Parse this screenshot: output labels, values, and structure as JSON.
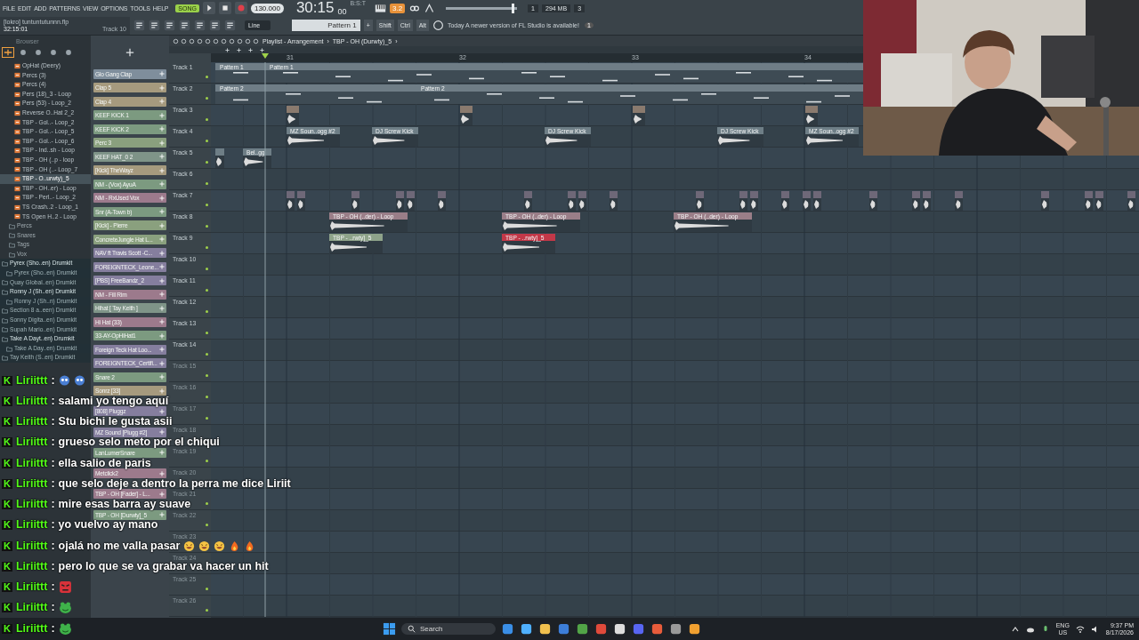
{
  "menu": [
    "FILE",
    "EDIT",
    "ADD",
    "PATTERNS",
    "VIEW",
    "OPTIONS",
    "TOOLS",
    "HELP"
  ],
  "project": {
    "file": "[lokro] tuntuntutunnn.flp",
    "position": "32:15:01",
    "hint": "Track 10"
  },
  "transport": {
    "mode": "SONG",
    "tempo": "130.000",
    "time": "30:15",
    "time_ticks": "00",
    "time_format": "B:S:T",
    "snap": "3.2"
  },
  "master_volume": {
    "level": 0.92
  },
  "monitor": {
    "cpu": "1",
    "polyphony": "3",
    "memory": "294 MB"
  },
  "input": "Line",
  "pattern": "Pattern 1",
  "pattern_add": "+",
  "modifiers": [
    "Shift",
    "Ctrl",
    "Alt"
  ],
  "news": {
    "day": "Today",
    "text": "A newer version of FL Studio is available!",
    "badge": "1"
  },
  "browser": {
    "title": "Browser",
    "items": [
      {
        "kind": "file",
        "name": "OpHat (Deery)",
        "selected": false
      },
      {
        "kind": "file",
        "name": "Percs (3)",
        "selected": false
      },
      {
        "kind": "file",
        "name": "Percs (4)",
        "selected": false
      },
      {
        "kind": "file",
        "name": "Pers (18)_3 - Loop",
        "selected": false
      },
      {
        "kind": "file",
        "name": "Pers (53) - Loop_2",
        "selected": false
      },
      {
        "kind": "file",
        "name": "Reverse O..Hat 2_2",
        "selected": false
      },
      {
        "kind": "file",
        "name": "TBP - Gol..- Loop_2",
        "selected": false
      },
      {
        "kind": "file",
        "name": "TBP - Gol..- Loop_5",
        "selected": false
      },
      {
        "kind": "file",
        "name": "TBP - Gol..- Loop_6",
        "selected": false
      },
      {
        "kind": "file",
        "name": "TBP - Ind..sh - Loop",
        "selected": false
      },
      {
        "kind": "file",
        "name": "TBP - OH (..p - loop",
        "selected": false
      },
      {
        "kind": "file",
        "name": "TBP - OH (..- Loop_7",
        "selected": false
      },
      {
        "kind": "file",
        "name": "TBP - O..urwty)_5",
        "selected": true
      },
      {
        "kind": "file",
        "name": "TBP - OH..er) - Loop",
        "selected": false
      },
      {
        "kind": "file",
        "name": "TBP - Perl..- Loop_2",
        "selected": false
      },
      {
        "kind": "file",
        "name": "TS Crash..2 - Loop_1",
        "selected": false
      },
      {
        "kind": "file",
        "name": "TS Open H..2 - Loop",
        "selected": false
      },
      {
        "kind": "folder",
        "name": "Percs",
        "selected": false
      },
      {
        "kind": "folder",
        "name": "Snares",
        "selected": false
      },
      {
        "kind": "folder",
        "name": "Tags",
        "selected": false
      },
      {
        "kind": "folder",
        "name": "Vox",
        "selected": false
      },
      {
        "kind": "kit",
        "name": "Pyrex (Sho..en) Drumkit",
        "selected": false,
        "expanded": true,
        "children": [
          {
            "kind": "kit",
            "name": "Pyrex (Sho..en) Drumkit",
            "selected": false,
            "expanded": false
          }
        ]
      },
      {
        "kind": "kit",
        "name": "Quay Global..en) Drumkit",
        "selected": false,
        "expanded": false
      },
      {
        "kind": "kit",
        "name": "Ronny J (Sh..en) Drumkit",
        "selected": false,
        "expanded": true,
        "children": [
          {
            "kind": "kit",
            "name": "Ronny J (Sh..n) Drumkit",
            "selected": false,
            "expanded": false
          }
        ]
      },
      {
        "kind": "kit",
        "name": "Section 8 a..een) Drumkit",
        "selected": false,
        "expanded": false
      },
      {
        "kind": "kit",
        "name": "Sonny Digita..en) Drumkit",
        "selected": false,
        "expanded": false
      },
      {
        "kind": "kit",
        "name": "Supah Mario..en) Drumkit",
        "selected": false,
        "expanded": false
      },
      {
        "kind": "kit",
        "name": "Take A Dayt..en) Drumkit",
        "selected": false,
        "expanded": true,
        "children": [
          {
            "kind": "kit",
            "name": "Take A Day..en) Drumkit",
            "selected": false,
            "expanded": false
          }
        ]
      },
      {
        "kind": "kit",
        "name": "Tay Keith (S..en) Drumkit",
        "selected": false,
        "expanded": false
      }
    ]
  },
  "channels": [
    {
      "name": "Glo Gang Clap",
      "color": "#7f8e9c"
    },
    {
      "name": "Clap 5",
      "color": "#a69a7e"
    },
    {
      "name": "Clap 4",
      "color": "#a69a7e"
    },
    {
      "name": "KEEF KICK 1",
      "color": "#7c9a80"
    },
    {
      "name": "KEEF KICK 2",
      "color": "#7c9a80"
    },
    {
      "name": "Perc 3",
      "color": "#8aa07e"
    },
    {
      "name": "KEEF HAT_0 2",
      "color": "#7f9488"
    },
    {
      "name": "[Kick] TheWayz",
      "color": "#a69a7e"
    },
    {
      "name": "NM - (Vox) AyuA",
      "color": "#7c9a80"
    },
    {
      "name": "NM - RxUsed Vox",
      "color": "#9c7a8c"
    },
    {
      "name": "Snr (A-Town b)",
      "color": "#7c9a80"
    },
    {
      "name": "[Kick] - Pierre",
      "color": "#8aa07e"
    },
    {
      "name": "ConcreteJungle Hat L...",
      "color": "#8aa07e"
    },
    {
      "name": "NAV ft Travis Scott -C...",
      "color": "#857e9e"
    },
    {
      "name": "FOREIGNTECK_Leone...",
      "color": "#857e9e"
    },
    {
      "name": "[PBS] FreeBandz_2",
      "color": "#857e9e"
    },
    {
      "name": "NM - Fill Rim",
      "color": "#9c7a8c"
    },
    {
      "name": "Hihat [ Tay Keith ]",
      "color": "#7f9488"
    },
    {
      "name": "Hi Hat (33)",
      "color": "#9c7a8c"
    },
    {
      "name": "33-AY-OpHiHat1",
      "color": "#7c9a80"
    },
    {
      "name": "Foreign Teck Hat Loo...",
      "color": "#857e9e"
    },
    {
      "name": "FOREIGNTECK_Certifi...",
      "color": "#857e9e"
    },
    {
      "name": "Snare 2",
      "color": "#7c9a80"
    },
    {
      "name": "Sonrz [33]",
      "color": "#a69a7e"
    },
    {
      "name": "[808] Pluggz",
      "color": "#857e9e"
    },
    {
      "name": "MZ Sound [Plugg #2]",
      "color": "#857e9e"
    },
    {
      "name": "LanLumerSnare",
      "color": "#7c9a80"
    },
    {
      "name": "Metclick2",
      "color": "#9c7a8c"
    },
    {
      "name": "TBP - OH [Fader] - L...",
      "color": "#9c7a8c"
    },
    {
      "name": "TBP - OH [Durwty]_5",
      "color": "#7c9a80"
    }
  ],
  "playlist": {
    "title": "Playlist - Arrangement",
    "crumb_sep": "›",
    "pattern": "TBP - OH (Durwty)_5",
    "ruler": [
      "31",
      "32",
      "33",
      "34"
    ],
    "tracks": [
      {
        "name": "Track 1",
        "clips": [
          {
            "kind": "pattern",
            "label": "Pattern 1",
            "color": "#6f7d86"
          },
          {
            "kind": "pattern",
            "label": "Pattern 1",
            "color": "#6f7d86"
          }
        ]
      },
      {
        "name": "Track 2",
        "clips": [
          {
            "kind": "pattern",
            "label": "Pattern 2",
            "color": "#6f7d86"
          },
          {
            "kind": "pattern",
            "label": "Pattern 2",
            "color": "#6f7d86"
          }
        ]
      },
      {
        "name": "Track 3",
        "clips": [
          {
            "kind": "audio",
            "color": "#8a7a6e"
          },
          {
            "kind": "audio",
            "color": "#8a7a6e"
          },
          {
            "kind": "audio",
            "color": "#8a7a6e"
          },
          {
            "kind": "audio",
            "color": "#8a7a6e"
          }
        ]
      },
      {
        "name": "Track 4",
        "clips": [
          {
            "kind": "audio",
            "label": "MZ Soun..ogg #2",
            "color": "#6e7e86"
          },
          {
            "kind": "audio",
            "label": "DJ Screw Kick",
            "color": "#6e7e86"
          },
          {
            "kind": "audio",
            "label": "DJ Screw Kick",
            "color": "#6e7e86"
          },
          {
            "kind": "audio",
            "label": "DJ Screw Kick",
            "color": "#6e7e86"
          },
          {
            "kind": "audio",
            "label": "MZ Soun..ogg #2",
            "color": "#6e7e86"
          }
        ]
      },
      {
        "name": "Track 5",
        "clips": [
          {
            "kind": "audio",
            "color": "#6e7e86"
          },
          {
            "kind": "audio",
            "label": "Bel..gg",
            "color": "#6e7e86"
          }
        ]
      },
      {
        "name": "Track 6"
      },
      {
        "name": "Track 7",
        "clips": [
          {
            "kind": "audio",
            "color": "#6e6878"
          },
          {
            "kind": "audio",
            "color": "#6e6878"
          },
          {
            "kind": "audio",
            "color": "#6e6878"
          },
          {
            "kind": "audio",
            "color": "#6e6878"
          },
          {
            "kind": "audio",
            "color": "#6e6878"
          },
          {
            "kind": "audio",
            "color": "#6e6878"
          },
          {
            "kind": "audio",
            "color": "#6e6878"
          },
          {
            "kind": "audio",
            "color": "#6e6878"
          },
          {
            "kind": "audio",
            "color": "#6e6878"
          },
          {
            "kind": "audio",
            "color": "#6e6878"
          },
          {
            "kind": "audio",
            "color": "#6e6878"
          },
          {
            "kind": "audio",
            "color": "#6e6878"
          },
          {
            "kind": "audio",
            "color": "#6e6878"
          },
          {
            "kind": "audio",
            "color": "#6e6878"
          },
          {
            "kind": "audio",
            "color": "#6e6878"
          },
          {
            "kind": "audio",
            "color": "#6e6878"
          },
          {
            "kind": "audio",
            "color": "#6e6878"
          },
          {
            "kind": "audio",
            "color": "#6e6878"
          },
          {
            "kind": "audio",
            "color": "#6e6878"
          },
          {
            "kind": "audio",
            "color": "#6e6878"
          },
          {
            "kind": "audio",
            "color": "#6e6878"
          },
          {
            "kind": "audio",
            "color": "#6e6878"
          },
          {
            "kind": "audio",
            "color": "#6e6878"
          },
          {
            "kind": "audio",
            "color": "#6e6878"
          }
        ]
      },
      {
        "name": "Track 8",
        "clips": [
          {
            "kind": "audio",
            "label": "TBP - OH (..der) - Loop",
            "color": "#9a7e88"
          },
          {
            "kind": "audio",
            "label": "TBP - OH (..der) - Loop",
            "color": "#9a7e88"
          },
          {
            "kind": "audio",
            "label": "TBP - OH (..der) - Loop",
            "color": "#9a7e88"
          }
        ]
      },
      {
        "name": "Track 9",
        "clips": [
          {
            "kind": "audio",
            "label": "TBP - ..rwty]_5",
            "color": "#8ea38a"
          },
          {
            "kind": "audio",
            "label": "TBP - ..rwty]_5",
            "color": "#c23848"
          }
        ]
      },
      {
        "name": "Track 10"
      },
      {
        "name": "Track 11"
      },
      {
        "name": "Track 12"
      },
      {
        "name": "Track 13"
      },
      {
        "name": "Track 14"
      },
      {
        "name": "Track 15"
      },
      {
        "name": "Track 16"
      },
      {
        "name": "Track 17"
      },
      {
        "name": "Track 18"
      },
      {
        "name": "Track 19"
      },
      {
        "name": "Track 20"
      },
      {
        "name": "Track 21"
      },
      {
        "name": "Track 22"
      },
      {
        "name": "Track 23"
      },
      {
        "name": "Track 24"
      },
      {
        "name": "Track 25"
      },
      {
        "name": "Track 26"
      }
    ]
  },
  "chat": [
    {
      "badge": "K",
      "user": "Liriittt",
      "sep": ":",
      "emotes": [
        {
          "kind": "skull"
        },
        {
          "kind": "skull"
        }
      ]
    },
    {
      "badge": "K",
      "user": "Liriittt",
      "sep": ":",
      "text": "salami yo tengo aquí"
    },
    {
      "badge": "K",
      "user": "Liriittt",
      "sep": ":",
      "text": "Stu bichi le gusta asii"
    },
    {
      "badge": "K",
      "user": "Liriittt",
      "sep": ":",
      "text": "grueso selo meto por el chiqui"
    },
    {
      "badge": "K",
      "user": "Liriittt",
      "sep": ":",
      "text": "ella salio de paris"
    },
    {
      "badge": "K",
      "user": "Liriittt",
      "sep": ":",
      "text": "que selo deje a dentro la perra me dice Liriit"
    },
    {
      "badge": "K",
      "user": "Liriittt",
      "sep": ":",
      "text": "mire esas barra ay suave"
    },
    {
      "badge": "K",
      "user": "Liriittt",
      "sep": ":",
      "text": "yo vuelvo ay mano"
    },
    {
      "badge": "K",
      "user": "Liriittt",
      "sep": ":",
      "text": "ojalá no me valla pasar",
      "emotes": [
        {
          "kind": "laugh"
        },
        {
          "kind": "laugh"
        },
        {
          "kind": "laugh"
        },
        {
          "kind": "fire"
        },
        {
          "kind": "fire"
        }
      ]
    },
    {
      "badge": "K",
      "user": "Liriittt",
      "sep": ":",
      "text": "pero lo que se va grabar va hacer un hit"
    },
    {
      "badge": "K",
      "user": "Liriittt",
      "sep": ":",
      "emotes": [
        {
          "kind": "angry"
        }
      ]
    },
    {
      "badge": "K",
      "user": "Liriittt",
      "sep": ":",
      "emotes": [
        {
          "kind": "frog"
        }
      ]
    },
    {
      "badge": "K",
      "user": "Liriittt",
      "sep": ":",
      "emotes": [
        {
          "kind": "frog"
        }
      ]
    }
  ],
  "taskbar": {
    "search": "Search",
    "language": "ENG",
    "region": "US",
    "time": "9:37 PM",
    "date": "8/17/2026"
  }
}
